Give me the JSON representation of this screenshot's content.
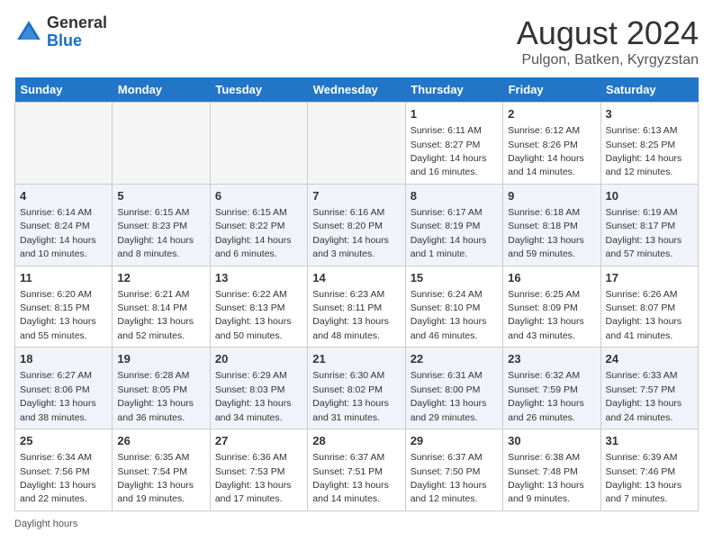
{
  "header": {
    "logo_general": "General",
    "logo_blue": "Blue",
    "month_year": "August 2024",
    "location": "Pulgon, Batken, Kyrgyzstan"
  },
  "weekdays": [
    "Sunday",
    "Monday",
    "Tuesday",
    "Wednesday",
    "Thursday",
    "Friday",
    "Saturday"
  ],
  "weeks": [
    [
      {
        "day": "",
        "info": ""
      },
      {
        "day": "",
        "info": ""
      },
      {
        "day": "",
        "info": ""
      },
      {
        "day": "",
        "info": ""
      },
      {
        "day": "1",
        "info": "Sunrise: 6:11 AM\nSunset: 8:27 PM\nDaylight: 14 hours and 16 minutes."
      },
      {
        "day": "2",
        "info": "Sunrise: 6:12 AM\nSunset: 8:26 PM\nDaylight: 14 hours and 14 minutes."
      },
      {
        "day": "3",
        "info": "Sunrise: 6:13 AM\nSunset: 8:25 PM\nDaylight: 14 hours and 12 minutes."
      }
    ],
    [
      {
        "day": "4",
        "info": "Sunrise: 6:14 AM\nSunset: 8:24 PM\nDaylight: 14 hours and 10 minutes."
      },
      {
        "day": "5",
        "info": "Sunrise: 6:15 AM\nSunset: 8:23 PM\nDaylight: 14 hours and 8 minutes."
      },
      {
        "day": "6",
        "info": "Sunrise: 6:15 AM\nSunset: 8:22 PM\nDaylight: 14 hours and 6 minutes."
      },
      {
        "day": "7",
        "info": "Sunrise: 6:16 AM\nSunset: 8:20 PM\nDaylight: 14 hours and 3 minutes."
      },
      {
        "day": "8",
        "info": "Sunrise: 6:17 AM\nSunset: 8:19 PM\nDaylight: 14 hours and 1 minute."
      },
      {
        "day": "9",
        "info": "Sunrise: 6:18 AM\nSunset: 8:18 PM\nDaylight: 13 hours and 59 minutes."
      },
      {
        "day": "10",
        "info": "Sunrise: 6:19 AM\nSunset: 8:17 PM\nDaylight: 13 hours and 57 minutes."
      }
    ],
    [
      {
        "day": "11",
        "info": "Sunrise: 6:20 AM\nSunset: 8:15 PM\nDaylight: 13 hours and 55 minutes."
      },
      {
        "day": "12",
        "info": "Sunrise: 6:21 AM\nSunset: 8:14 PM\nDaylight: 13 hours and 52 minutes."
      },
      {
        "day": "13",
        "info": "Sunrise: 6:22 AM\nSunset: 8:13 PM\nDaylight: 13 hours and 50 minutes."
      },
      {
        "day": "14",
        "info": "Sunrise: 6:23 AM\nSunset: 8:11 PM\nDaylight: 13 hours and 48 minutes."
      },
      {
        "day": "15",
        "info": "Sunrise: 6:24 AM\nSunset: 8:10 PM\nDaylight: 13 hours and 46 minutes."
      },
      {
        "day": "16",
        "info": "Sunrise: 6:25 AM\nSunset: 8:09 PM\nDaylight: 13 hours and 43 minutes."
      },
      {
        "day": "17",
        "info": "Sunrise: 6:26 AM\nSunset: 8:07 PM\nDaylight: 13 hours and 41 minutes."
      }
    ],
    [
      {
        "day": "18",
        "info": "Sunrise: 6:27 AM\nSunset: 8:06 PM\nDaylight: 13 hours and 38 minutes."
      },
      {
        "day": "19",
        "info": "Sunrise: 6:28 AM\nSunset: 8:05 PM\nDaylight: 13 hours and 36 minutes."
      },
      {
        "day": "20",
        "info": "Sunrise: 6:29 AM\nSunset: 8:03 PM\nDaylight: 13 hours and 34 minutes."
      },
      {
        "day": "21",
        "info": "Sunrise: 6:30 AM\nSunset: 8:02 PM\nDaylight: 13 hours and 31 minutes."
      },
      {
        "day": "22",
        "info": "Sunrise: 6:31 AM\nSunset: 8:00 PM\nDaylight: 13 hours and 29 minutes."
      },
      {
        "day": "23",
        "info": "Sunrise: 6:32 AM\nSunset: 7:59 PM\nDaylight: 13 hours and 26 minutes."
      },
      {
        "day": "24",
        "info": "Sunrise: 6:33 AM\nSunset: 7:57 PM\nDaylight: 13 hours and 24 minutes."
      }
    ],
    [
      {
        "day": "25",
        "info": "Sunrise: 6:34 AM\nSunset: 7:56 PM\nDaylight: 13 hours and 22 minutes."
      },
      {
        "day": "26",
        "info": "Sunrise: 6:35 AM\nSunset: 7:54 PM\nDaylight: 13 hours and 19 minutes."
      },
      {
        "day": "27",
        "info": "Sunrise: 6:36 AM\nSunset: 7:53 PM\nDaylight: 13 hours and 17 minutes."
      },
      {
        "day": "28",
        "info": "Sunrise: 6:37 AM\nSunset: 7:51 PM\nDaylight: 13 hours and 14 minutes."
      },
      {
        "day": "29",
        "info": "Sunrise: 6:37 AM\nSunset: 7:50 PM\nDaylight: 13 hours and 12 minutes."
      },
      {
        "day": "30",
        "info": "Sunrise: 6:38 AM\nSunset: 7:48 PM\nDaylight: 13 hours and 9 minutes."
      },
      {
        "day": "31",
        "info": "Sunrise: 6:39 AM\nSunset: 7:46 PM\nDaylight: 13 hours and 7 minutes."
      }
    ]
  ],
  "footer": {
    "daylight_label": "Daylight hours"
  }
}
